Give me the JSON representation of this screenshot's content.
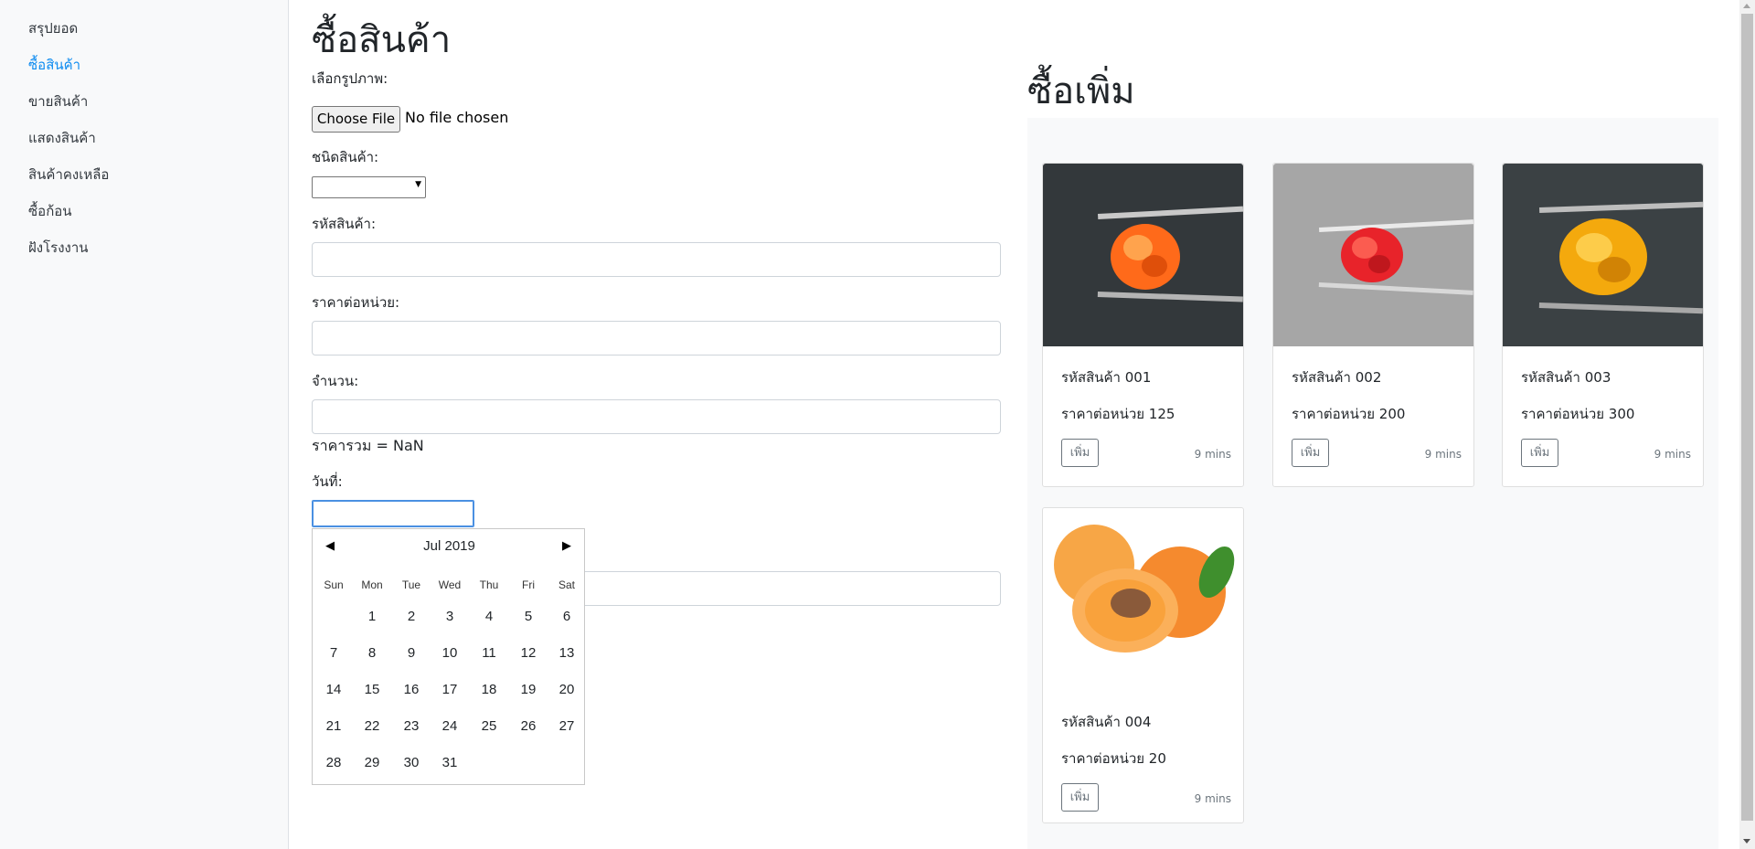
{
  "sidebar": {
    "items": [
      {
        "label": "สรุปยอด"
      },
      {
        "label": "ซื้อสินค้า"
      },
      {
        "label": "ขายสินค้า"
      },
      {
        "label": "แสดงสินค้า"
      },
      {
        "label": "สินค้าคงเหลือ"
      },
      {
        "label": "ซื้อก้อน"
      },
      {
        "label": "ฝังโรงงาน"
      }
    ],
    "active_index": 1
  },
  "form": {
    "title": "ซื้อสินค้า",
    "image_label": "เลือกรูปภาพ:",
    "file_button": "Choose File",
    "file_status": "No file chosen",
    "type_label": "ชนิดสินค้า:",
    "type_value": "",
    "code_label": "รหัสสินค้า:",
    "code_value": "",
    "unit_price_label": "ราคาต่อหน่วย:",
    "unit_price_value": "",
    "quantity_label": "จำนวน:",
    "quantity_value": "",
    "total_text": "ราคารวม = NaN",
    "date_label": "วันที่:",
    "date_value": ""
  },
  "calendar": {
    "month_label": "Jul 2019",
    "weekdays": [
      "Sun",
      "Mon",
      "Tue",
      "Wed",
      "Thu",
      "Fri",
      "Sat"
    ],
    "first_weekday_index": 1,
    "days_in_month": 31
  },
  "panel": {
    "title": "ซื้อเพิ่ม",
    "cards": [
      {
        "code": "รหัสสินค้า 001",
        "price": "ราคาต่อหน่วย 125",
        "button": "เพิ่ม",
        "time": "9 mins",
        "image": "orange-gem-tweezers",
        "accent": "#ff6a1a",
        "bg": "#3a3f42"
      },
      {
        "code": "รหัสสินค้า 002",
        "price": "ราคาต่อหน่วย 200",
        "button": "เพิ่ม",
        "time": "9 mins",
        "image": "red-gem-tweezers",
        "accent": "#e8232a",
        "bg": "#a9a9a9"
      },
      {
        "code": "รหัสสินค้า 003",
        "price": "ราคาต่อหน่วย 300",
        "button": "เพิ่ม",
        "time": "9 mins",
        "image": "yellow-gem-tweezers",
        "accent": "#f4a90d",
        "bg": "#3e4447"
      },
      {
        "code": "รหัสสินค้า 004",
        "price": "ราคาต่อหน่วย 20",
        "button": "เพิ่ม",
        "time": "9 mins",
        "image": "apricot-fruit",
        "accent": "#f59a3a",
        "bg": "#ffffff"
      }
    ]
  }
}
